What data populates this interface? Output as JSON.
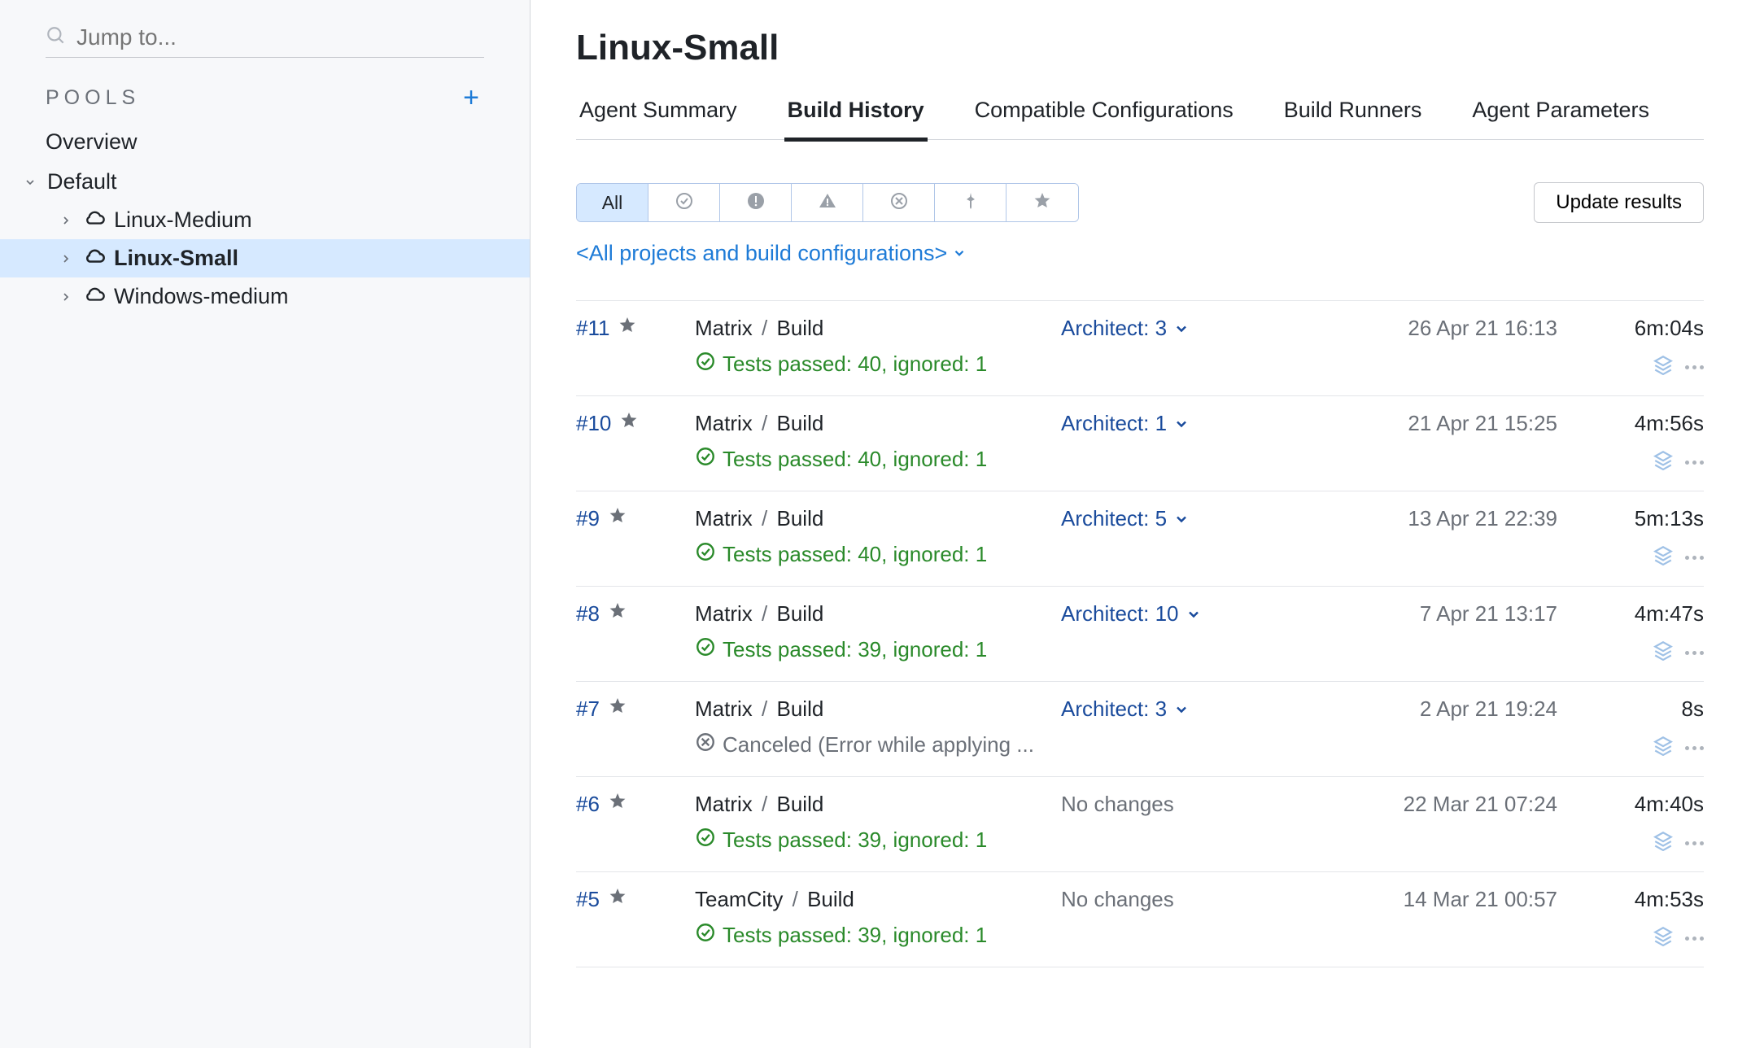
{
  "search": {
    "placeholder": "Jump to..."
  },
  "sidebar": {
    "pools_label": "POOLS",
    "overview_label": "Overview",
    "default_label": "Default",
    "agents": [
      "Linux-Medium",
      "Linux-Small",
      "Windows-medium"
    ]
  },
  "page": {
    "title": "Linux-Small"
  },
  "tabs": [
    "Agent Summary",
    "Build History",
    "Compatible Configurations",
    "Build Runners",
    "Agent Parameters"
  ],
  "filters": {
    "all_label": "All"
  },
  "update_results_label": "Update results",
  "scope_label": "<All projects and build configurations>",
  "separator": "/",
  "builds": [
    {
      "num": "#11",
      "project": "Matrix",
      "config": "Build",
      "status_type": "ok",
      "status": "Tests passed: 40, ignored: 1",
      "changes": "Architect: 3",
      "changes_type": "link",
      "date": "26 Apr 21 16:13",
      "duration": "6m:04s"
    },
    {
      "num": "#10",
      "project": "Matrix",
      "config": "Build",
      "status_type": "ok",
      "status": "Tests passed: 40, ignored: 1",
      "changes": "Architect: 1",
      "changes_type": "link",
      "date": "21 Apr 21 15:25",
      "duration": "4m:56s"
    },
    {
      "num": "#9",
      "project": "Matrix",
      "config": "Build",
      "status_type": "ok",
      "status": "Tests passed: 40, ignored: 1",
      "changes": "Architect: 5",
      "changes_type": "link",
      "date": "13 Apr 21 22:39",
      "duration": "5m:13s"
    },
    {
      "num": "#8",
      "project": "Matrix",
      "config": "Build",
      "status_type": "ok",
      "status": "Tests passed: 39, ignored: 1",
      "changes": "Architect: 10",
      "changes_type": "link",
      "date": "7 Apr 21 13:17",
      "duration": "4m:47s"
    },
    {
      "num": "#7",
      "project": "Matrix",
      "config": "Build",
      "status_type": "cancel",
      "status": "Canceled (Error while applying ...",
      "changes": "Architect: 3",
      "changes_type": "link",
      "date": "2 Apr 21 19:24",
      "duration": "8s"
    },
    {
      "num": "#6",
      "project": "Matrix",
      "config": "Build",
      "status_type": "ok",
      "status": "Tests passed: 39, ignored: 1",
      "changes": "No changes",
      "changes_type": "none",
      "date": "22 Mar 21 07:24",
      "duration": "4m:40s"
    },
    {
      "num": "#5",
      "project": "TeamCity",
      "config": "Build",
      "status_type": "ok",
      "status": "Tests passed: 39, ignored: 1",
      "changes": "No changes",
      "changes_type": "none",
      "date": "14 Mar 21 00:57",
      "duration": "4m:53s"
    }
  ]
}
